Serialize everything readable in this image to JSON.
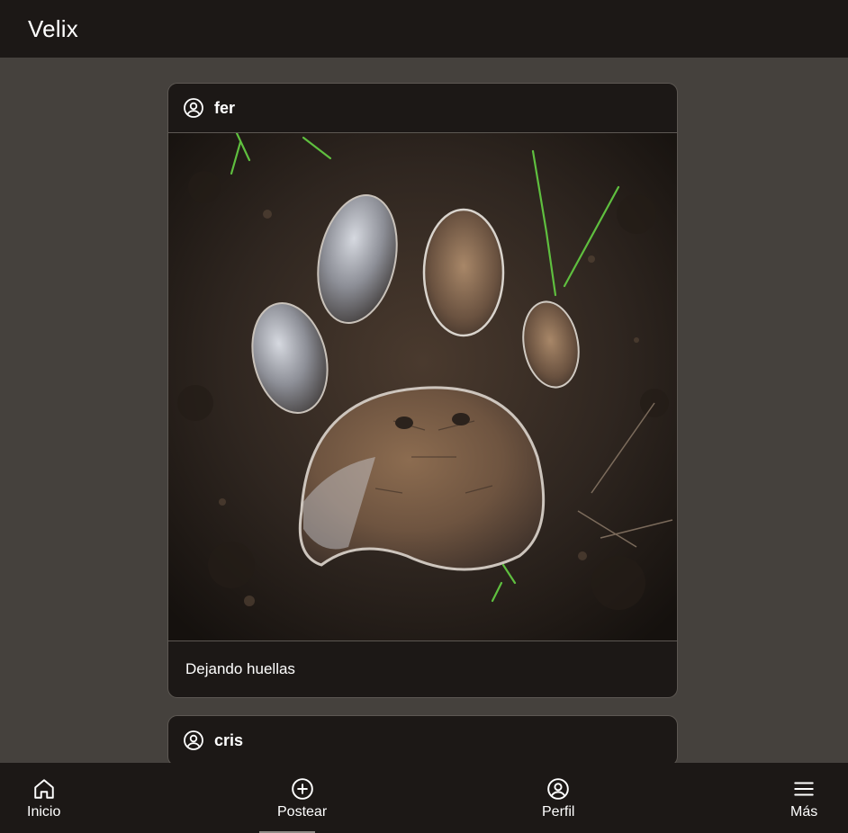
{
  "app": {
    "title": "Velix"
  },
  "posts": [
    {
      "username": "fer",
      "caption": "Dejando huellas",
      "image_alt": "Huella de tigre en el barro con el reflejo de un tigre en el agua"
    },
    {
      "username": "cris"
    }
  ],
  "bottom_nav": {
    "items": [
      {
        "label": "Inicio",
        "icon": "home-icon"
      },
      {
        "label": "Postear",
        "icon": "plus-circle-icon"
      },
      {
        "label": "Perfil",
        "icon": "user-circle-icon"
      },
      {
        "label": "Más",
        "icon": "menu-icon"
      }
    ]
  },
  "colors": {
    "background": "#45413d",
    "surface": "#1c1816",
    "border": "#5d5853",
    "text": "#ffffff"
  }
}
